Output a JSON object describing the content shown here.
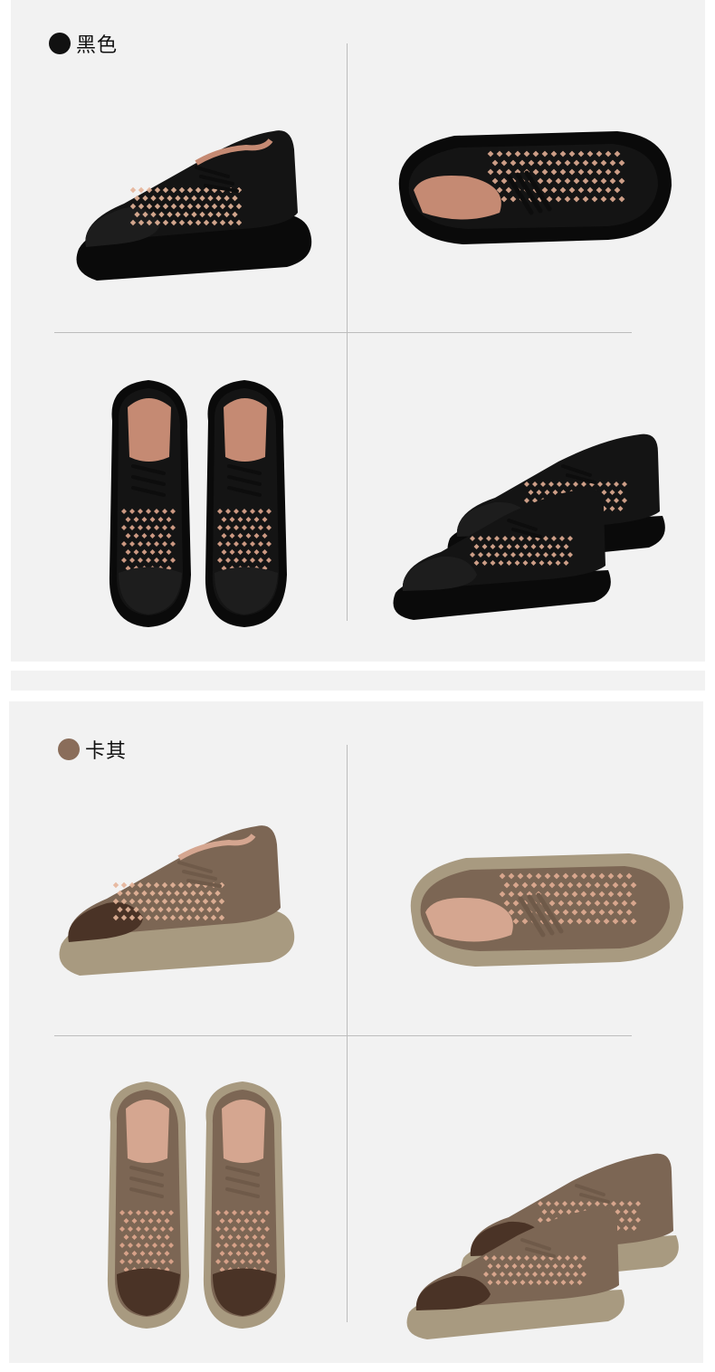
{
  "sections": [
    {
      "label": "黑色",
      "swatch_color": "#111111",
      "shoe_colors": {
        "upper": "#141414",
        "sole": "#0a0a0a",
        "toe": "#1d1d1d",
        "lining": "#c58a73",
        "lace": "#0d0d0d"
      },
      "views": [
        "side-view-icon",
        "bottom-view-icon",
        "top-view-icon",
        "pair-view-icon"
      ]
    },
    {
      "label": "卡其",
      "swatch_color": "#8a6d5a",
      "shoe_colors": {
        "upper": "#7c6654",
        "sole": "#a89a80",
        "toe": "#4a3326",
        "lining": "#d5a690",
        "lace": "#6f5a49"
      },
      "views": [
        "side-view-icon",
        "bottom-view-icon",
        "top-view-icon",
        "pair-view-icon"
      ]
    }
  ]
}
